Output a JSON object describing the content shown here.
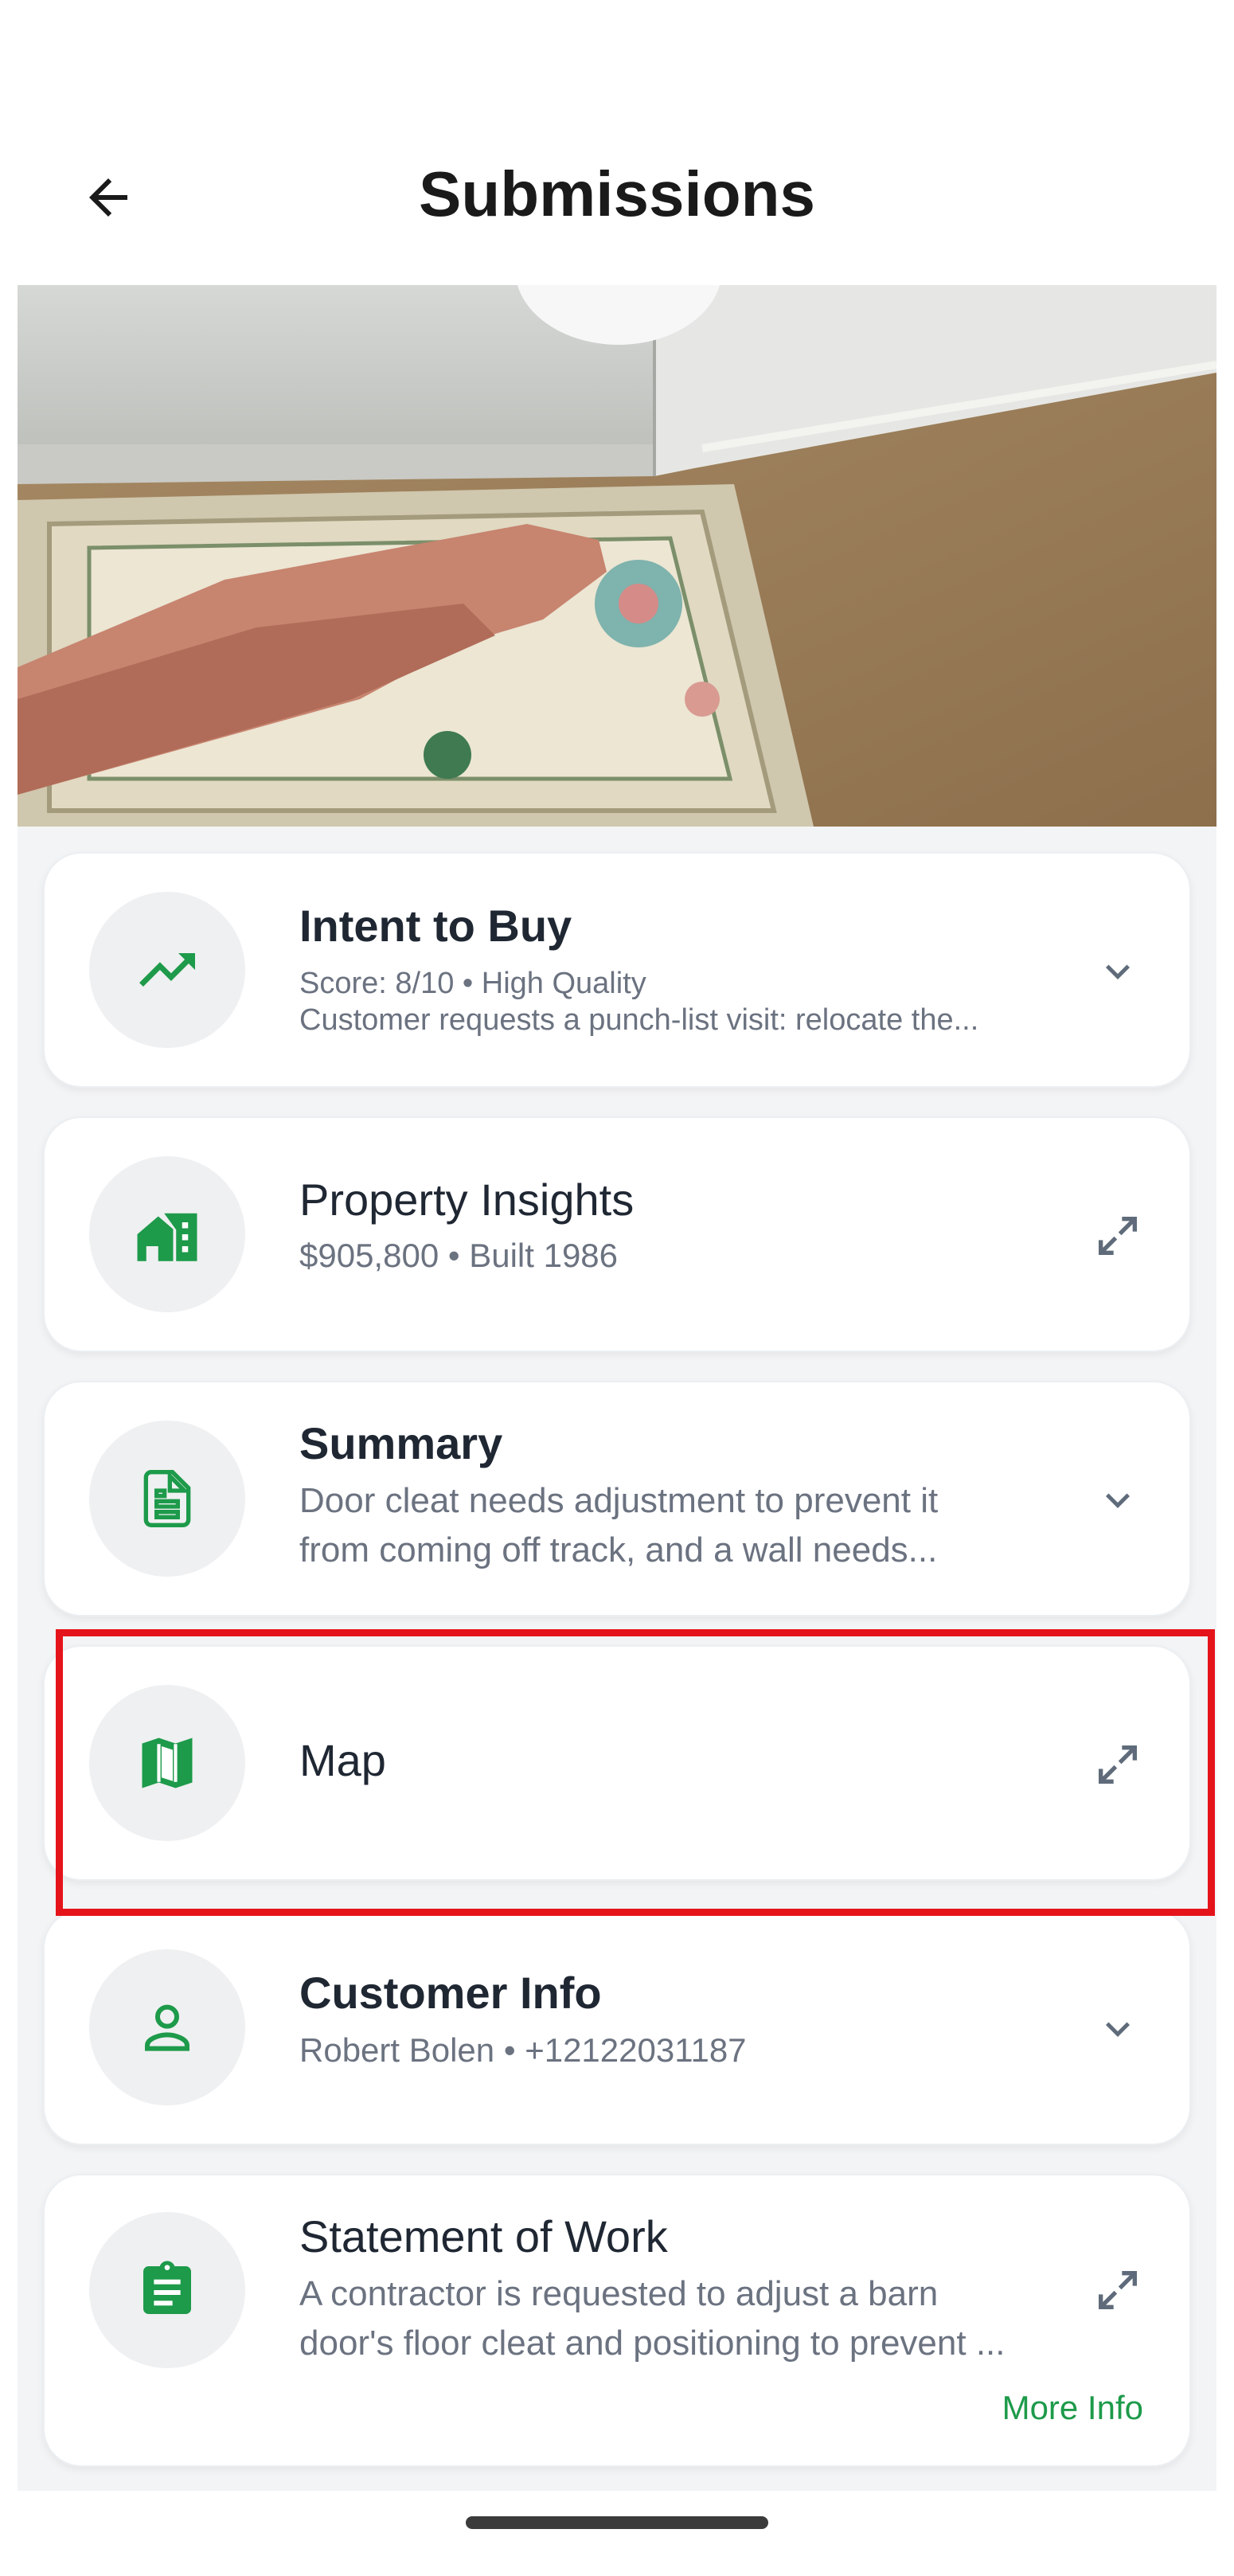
{
  "header": {
    "title": "Submissions",
    "back_icon": "arrow-left-icon"
  },
  "colors": {
    "accent": "#1d9a4a",
    "highlight": "#e5141b",
    "card_bg": "#ffffff",
    "page_bg": "#f3f4f6"
  },
  "cards": [
    {
      "id": "intent",
      "title": "Intent to Buy",
      "subtitle": "Score: 8/10 • High Quality",
      "description": "Customer requests a punch-list visit: relocate the...",
      "icon": "trending-up-icon",
      "action": "chevron-down-icon"
    },
    {
      "id": "property",
      "title": "Property Insights",
      "subtitle": "$905,800 • Built 1986",
      "icon": "house-icon",
      "action": "expand-icon"
    },
    {
      "id": "summary",
      "title": "Summary",
      "description_lines": [
        "Door cleat needs adjustment to prevent it",
        "from coming off track, and a wall needs..."
      ],
      "icon": "document-icon",
      "action": "chevron-down-icon"
    },
    {
      "id": "map",
      "title": "Map",
      "icon": "map-icon",
      "action": "expand-icon"
    },
    {
      "id": "customer",
      "title": "Customer Info",
      "subtitle": "Robert Bolen • +12122031187",
      "icon": "person-icon",
      "action": "chevron-down-icon"
    },
    {
      "id": "sow",
      "title": "Statement of Work",
      "description_lines": [
        "A contractor is requested to adjust a barn",
        "door's floor cleat and positioning to prevent ..."
      ],
      "link": "More Info",
      "icon": "clipboard-icon",
      "action": "expand-icon"
    }
  ]
}
